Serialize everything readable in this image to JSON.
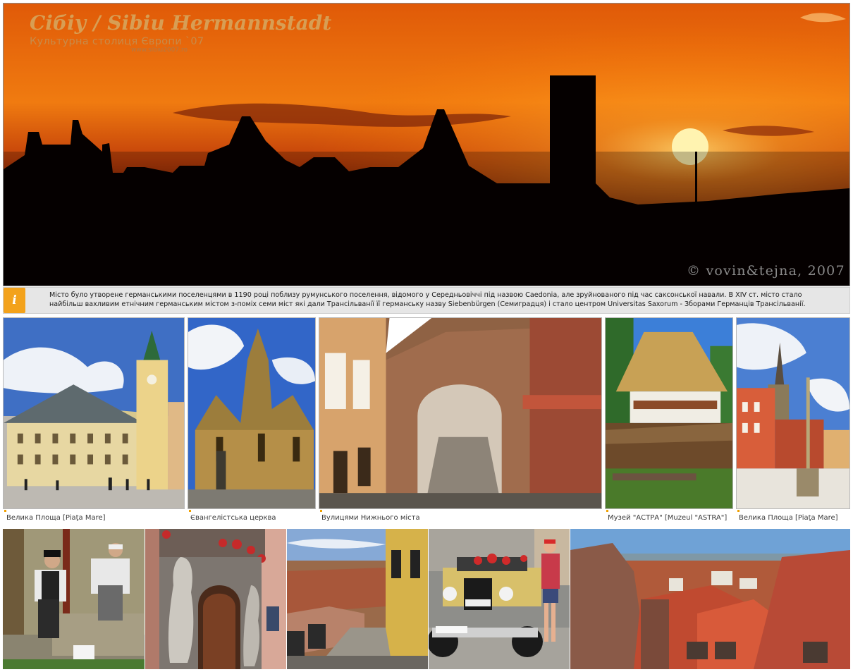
{
  "hero": {
    "title": "Сібіу / Sibiu Hermannstadt",
    "subtitle": "Культурна столиця Європи `07",
    "url": "www.sibiu2007.ro",
    "credit": "© vovin&tejna, 2007"
  },
  "info": {
    "icon_letter": "i",
    "text": "Місто було утворене германськими поселенцями в 1190 році поблизу румунського поселення, відомого у Середньовіччі під назвою Caedonia, але зруйнованого під час саксонської навали. В XIV ст. місто стало найбільш вахливим етнічним германським містом з-поміх семи міст які дали Трансільванії її германську назву Siebenbürgen (Семиградця) і стало центром Universitas Saxorum - Зборами Германців Трансільванії."
  },
  "gallery_row1": {
    "captions": [
      "Велика Площа [Piaţa Mare]",
      "Євангелістська церква",
      "Вулицями Нижнього міста",
      "Музей \"АСТРА\" [Muzeul \"ASTRA\"]",
      "Велика Площа [Piaţa Mare]"
    ]
  },
  "photos": [
    "piata-mare-council-building",
    "evangelical-church",
    "lower-town-stairs-passage",
    "astra-museum-thatched-house",
    "piata-mare-tower",
    "craftsmen-at-work",
    "baroque-doorway-statues",
    "lower-town-street-view",
    "vintage-car-and-woman",
    "red-roofs-panorama"
  ],
  "colors": {
    "info_icon": "#f3a21b",
    "info_bar": "#e6e6e6",
    "caption_marker": "#f0a000"
  }
}
